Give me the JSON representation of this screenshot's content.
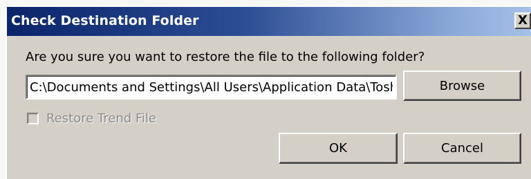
{
  "window": {
    "title": "Check Destination Folder",
    "close_label": "X"
  },
  "content": {
    "prompt": "Are you sure you want to restore the file to the following folder?",
    "path_value": "C:\\Documents and Settings\\All Users\\Application Data\\Tosh",
    "browse_label": "Browse",
    "restore_trend_label": "Restore Trend File",
    "restore_trend_checked": false,
    "restore_trend_enabled": false
  },
  "buttons": {
    "ok_label": "OK",
    "cancel_label": "Cancel"
  },
  "colors": {
    "title_bar_start": "#0a246a",
    "title_bar_end": "#a6c0e6",
    "dialog_face": "#d4d0c8",
    "disabled_text": "#8c8c8c"
  }
}
